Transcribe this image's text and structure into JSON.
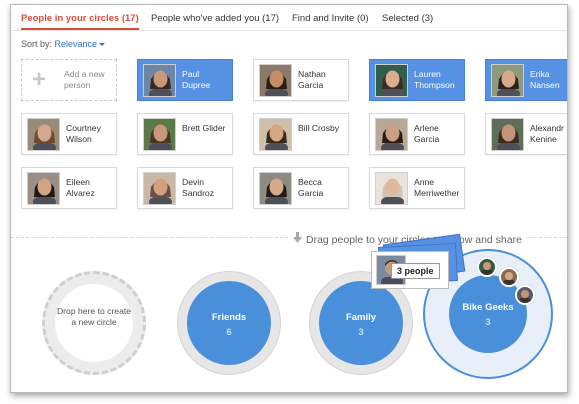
{
  "tabs": [
    {
      "label": "People in your circles (17)",
      "active": true
    },
    {
      "label": "People who've added you (17)",
      "active": false
    },
    {
      "label": "Find and Invite (0)",
      "active": false
    },
    {
      "label": "Selected (3)",
      "active": false
    }
  ],
  "sort": {
    "label": "Sort by:",
    "value": "Relevance"
  },
  "add_card": {
    "label": "Add a new\nperson"
  },
  "people": [
    {
      "name": "Paul\nDupree",
      "selected": true,
      "skin": "#c79a7a",
      "hair": "#3a2a20",
      "bg": "#6e86a8"
    },
    {
      "name": "Nathan\nGarcia",
      "selected": false,
      "skin": "#c58c68",
      "hair": "#2b1d14",
      "bg": "#8a7a6a"
    },
    {
      "name": "Lauren\nThompson",
      "selected": true,
      "skin": "#d9ae8f",
      "hair": "#3b2a1e",
      "bg": "#2f5e4a"
    },
    {
      "name": "Erika\nNansen",
      "selected": true,
      "skin": "#d6a98b",
      "hair": "#2c2218",
      "bg": "#8c9a7a"
    },
    {
      "name": "Courtney\nWilson",
      "selected": false,
      "skin": "#d4a88c",
      "hair": "#6b4a2e",
      "bg": "#9a8a7a"
    },
    {
      "name": "Brett Glider",
      "selected": false,
      "skin": "#c99878",
      "hair": "#4a3526",
      "bg": "#5a7a4a"
    },
    {
      "name": "Bill Crosby",
      "selected": false,
      "skin": "#d7a582",
      "hair": "#3a2a1e",
      "bg": "#d0c0a8"
    },
    {
      "name": "Arlene\nGarcia",
      "selected": false,
      "skin": "#caa084",
      "hair": "#2a1f16",
      "bg": "#b8a898"
    },
    {
      "name": "Alexandr\nKenine",
      "selected": false,
      "skin": "#c49476",
      "hair": "#3a2c20",
      "bg": "#5e6e58"
    },
    {
      "name": "Eileen\nAlvarez",
      "selected": false,
      "skin": "#d2a486",
      "hair": "#1e1814",
      "bg": "#9a8e86"
    },
    {
      "name": "Devin\nSandroz",
      "selected": false,
      "skin": "#d0a080",
      "hair": "#6a5040",
      "bg": "#c8b8a8"
    },
    {
      "name": "Becca\nGarcia",
      "selected": false,
      "skin": "#d5a98c",
      "hair": "#231a14",
      "bg": "#8e8a84"
    },
    {
      "name": "Anne\nMerriwether",
      "selected": false,
      "skin": "#e0b89c",
      "hair": "#cfc6b4",
      "bg": "#e8e4dc"
    }
  ],
  "drag_hint": "Drag people to your circles to follow and share",
  "drop_circle": {
    "label": "Drop here to\ncreate a new\ncircle"
  },
  "circles": [
    {
      "name": "Friends",
      "count": "6"
    },
    {
      "name": "Family",
      "count": "3"
    },
    {
      "name": "Bike Geeks",
      "count": "3"
    }
  ],
  "drag_badge": "3 people",
  "colors": {
    "accent": "#dd4b39",
    "selected": "#5791e3",
    "circle": "#4a8fda",
    "link": "#2a6dd4"
  }
}
